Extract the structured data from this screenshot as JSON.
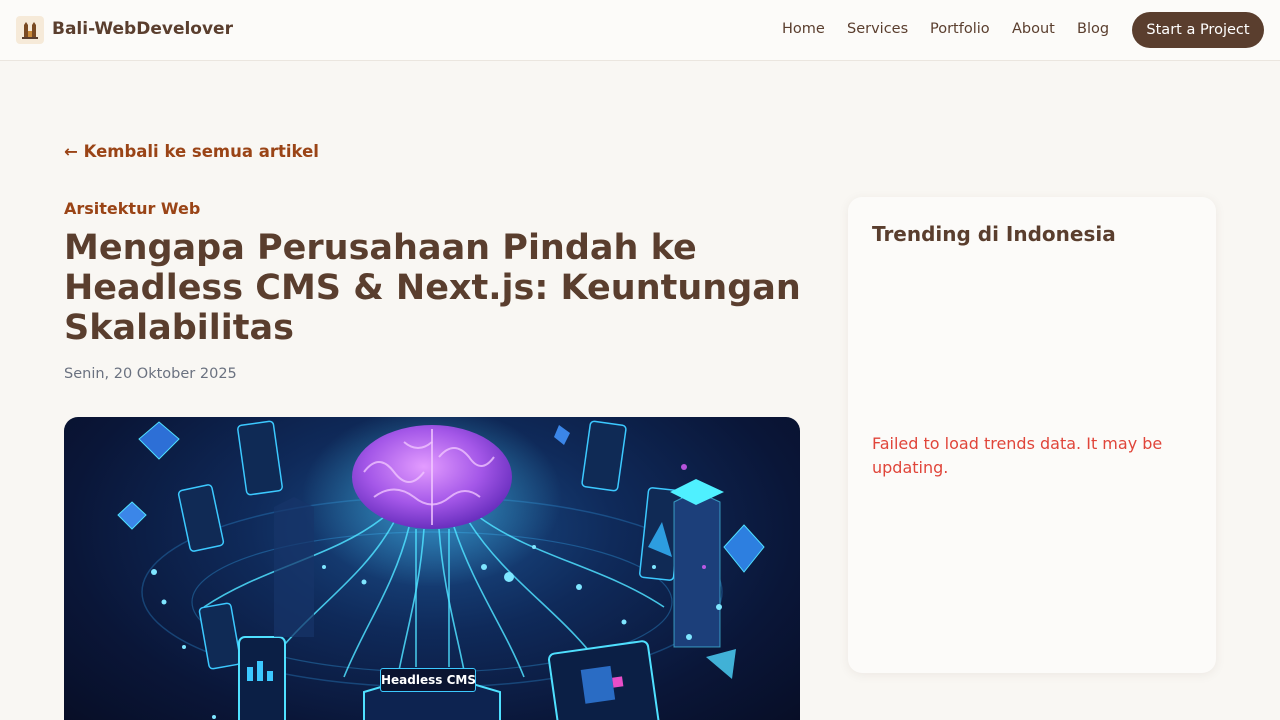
{
  "header": {
    "brand": "Bali-WebDevelover",
    "logo_icon": "bali-gate-logo-icon",
    "nav": [
      "Home",
      "Services",
      "Portfolio",
      "About",
      "Blog"
    ],
    "cta": "Start a Project"
  },
  "article": {
    "back_link": "← Kembali ke semua artikel",
    "category": "Arsitektur Web",
    "title": "Mengapa Perusahaan Pindah ke Headless CMS & Next.js: Keuntungan Skalabilitas",
    "date": "Senin, 20 Oktober 2025",
    "hero_label": "Headless CMS"
  },
  "sidebar": {
    "title": "Trending di Indonesia",
    "error": "Failed to load trends data. It may be updating."
  },
  "colors": {
    "brand_brown": "#5a3e2e",
    "accent_rust": "#9a4416",
    "error_red": "#e0453a",
    "page_bg": "#f9f7f3"
  }
}
